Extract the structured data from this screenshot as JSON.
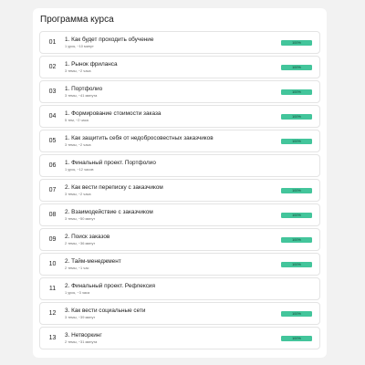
{
  "course": {
    "title": "Программа курса",
    "accent_color": "#43c59b",
    "lessons": [
      {
        "number": "01",
        "title": "1. Как будет проходить обучение",
        "meta": "1 урок, ~10 минут",
        "progress": 100,
        "progress_label": "100%"
      },
      {
        "number": "02",
        "title": "1. Рынок фриланса",
        "meta": "3 темы, ~2 часа",
        "progress": 100,
        "progress_label": "100%"
      },
      {
        "number": "03",
        "title": "1. Портфолио",
        "meta": "3 темы, ~41 минута",
        "progress": 100,
        "progress_label": "100%"
      },
      {
        "number": "04",
        "title": "1. Формирование стоимости заказа",
        "meta": "5 тем, ~2 часа",
        "progress": 100,
        "progress_label": "100%"
      },
      {
        "number": "05",
        "title": "1. Как защитить себя от недобросовестных заказчиков",
        "meta": "3 темы, ~2 часа",
        "progress": 100,
        "progress_label": "100%"
      },
      {
        "number": "06",
        "title": "1. Финальный проект. Портфолио",
        "meta": "1 урок, ~12 часов",
        "progress": null,
        "progress_label": ""
      },
      {
        "number": "07",
        "title": "2. Как вести переписку с заказчиком",
        "meta": "3 темы, ~2 часа",
        "progress": 100,
        "progress_label": "100%"
      },
      {
        "number": "08",
        "title": "2. Взаимодействие с заказчиком",
        "meta": "3 темы, ~50 минут",
        "progress": 100,
        "progress_label": "100%"
      },
      {
        "number": "09",
        "title": "2. Поиск заказов",
        "meta": "2 темы, ~36 минут",
        "progress": 100,
        "progress_label": "100%"
      },
      {
        "number": "10",
        "title": "2. Тайм-менеджмент",
        "meta": "2 темы, ~1 час",
        "progress": 100,
        "progress_label": "100%"
      },
      {
        "number": "11",
        "title": "2. Финальный проект. Рефлексия",
        "meta": "1 урок, ~3 часа",
        "progress": null,
        "progress_label": ""
      },
      {
        "number": "12",
        "title": "3. Как вести социальные сети",
        "meta": "3 темы, ~39 минут",
        "progress": 100,
        "progress_label": "100%"
      },
      {
        "number": "13",
        "title": "3. Нетворкинг",
        "meta": "2 темы, ~31 минута",
        "progress": 100,
        "progress_label": "100%"
      }
    ]
  }
}
